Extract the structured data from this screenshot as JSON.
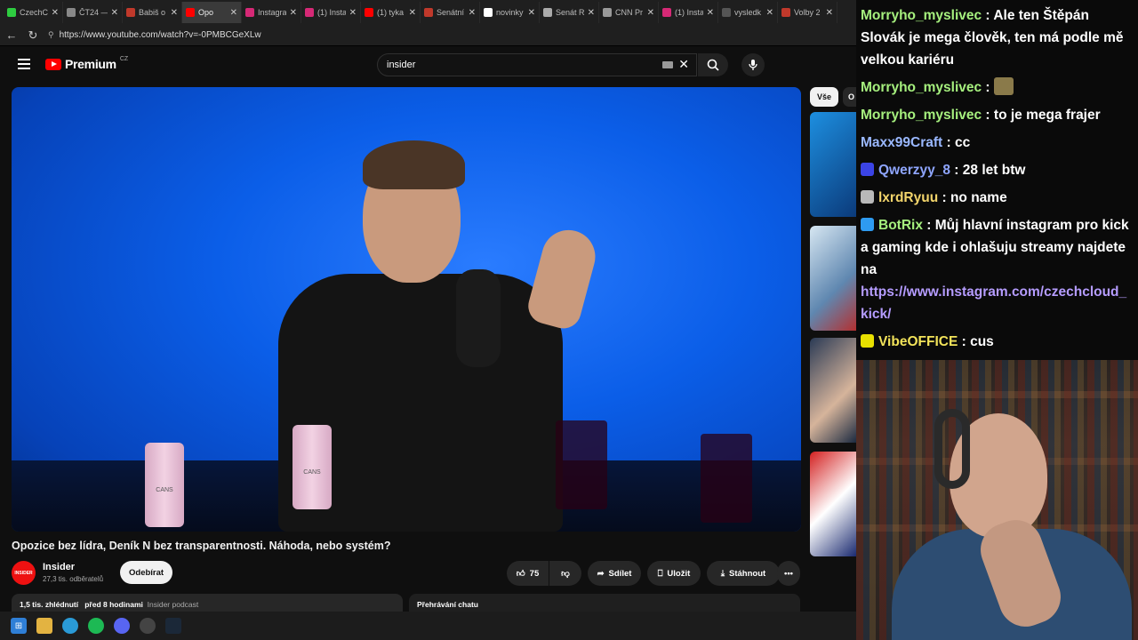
{
  "browser": {
    "tabs": [
      {
        "label": "CzechC",
        "color": "#2ecc40",
        "active": false
      },
      {
        "label": "ČT24 —",
        "color": "#888888",
        "active": false
      },
      {
        "label": "Babiš o",
        "color": "#c0392b",
        "active": false
      },
      {
        "label": "Opo",
        "color": "#ff0000",
        "active": true
      },
      {
        "label": "Instagra",
        "color": "#d62976",
        "active": false
      },
      {
        "label": "(1) Insta",
        "color": "#d62976",
        "active": false
      },
      {
        "label": "(1) tyka",
        "color": "#ff0000",
        "active": false
      },
      {
        "label": "Senátní",
        "color": "#c0392b",
        "active": false
      },
      {
        "label": "novinky",
        "color": "#ffffff",
        "active": false
      },
      {
        "label": "Senát R",
        "color": "#aaaaaa",
        "active": false
      },
      {
        "label": "CNN Pr",
        "color": "#999999",
        "active": false
      },
      {
        "label": "(1) Insta",
        "color": "#d62976",
        "active": false
      },
      {
        "label": "vysledk",
        "color": "#555555",
        "active": false
      },
      {
        "label": "Volby 2",
        "color": "#c0392b",
        "active": false
      }
    ],
    "url": "https://www.youtube.com/watch?v=-0PMBCGeXLw"
  },
  "youtube": {
    "logo_word": "Premium",
    "logo_cc": "CZ",
    "search_value": "insider",
    "video_title": "Opozice bez lídra, Deník N bez transparentnosti. Náhoda, nebo systém?",
    "channel": {
      "avatar_text": "INSIDER",
      "name": "Insider",
      "subs": "27,3 tis. odběratelů",
      "subscribe_label": "Odebírat"
    },
    "actions": {
      "like_count": "75",
      "share_label": "Sdílet",
      "save_label": "Uložit",
      "download_label": "Stáhnout"
    },
    "meta": {
      "views": "1,5 tis. zhlédnutí",
      "time": "před 8 hodinami",
      "playlist": "Insider podcast"
    },
    "chat_replay_label": "Přehrávání chatu",
    "chips": [
      "Vše",
      "O"
    ],
    "video_can_label": "CANS"
  },
  "chat": {
    "messages": [
      {
        "user": "Morryho_myslivec",
        "user_color": "#a6f07e",
        "text": "Ale ten Štěpán Slovák je mega člověk, ten má podle mě velkou kariéru",
        "badge": ""
      },
      {
        "user": "Morryho_myslivec",
        "user_color": "#a6f07e",
        "text": "",
        "badge": "",
        "emote": true
      },
      {
        "user": "Morryho_myslivec",
        "user_color": "#a6f07e",
        "text": "to je mega frajer",
        "badge": ""
      },
      {
        "user": "Maxx99Craft",
        "user_color": "#9ab8ff",
        "text": "cc",
        "badge": ""
      },
      {
        "user": "Qwerzyy_8",
        "user_color": "#8fa6ff",
        "text": "28 let btw",
        "badge": "#3b44e6"
      },
      {
        "user": "lxrdRyuu",
        "user_color": "#f2d46b",
        "text": "no name",
        "badge": "#b9b9b9"
      },
      {
        "user": "BotRix",
        "user_color": "#a6f07e",
        "text": "Můj hlavní instagram pro kick a gaming kde i ohlašuju streamy najdete na",
        "badge": "#2e9bf0",
        "link": "https://www.instagram.com/czechcloud_kick/"
      },
      {
        "user": "VibeOFFICE",
        "user_color": "#f2e35a",
        "text": "cus",
        "badge": "#e8e000"
      }
    ]
  }
}
